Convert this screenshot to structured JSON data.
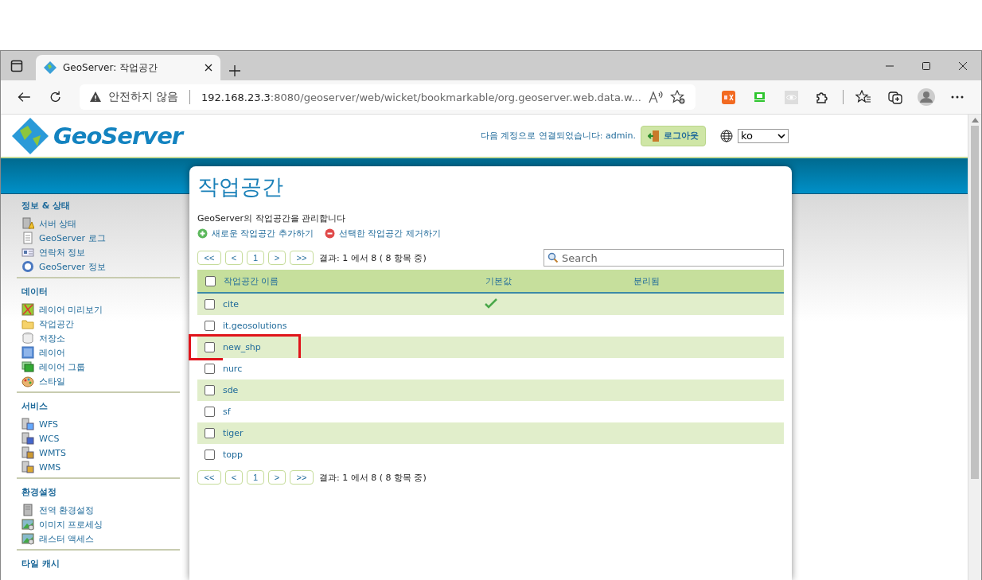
{
  "browser": {
    "tab_title": "GeoServer: 작업공간",
    "security": "안전하지 않음",
    "url_host": "192.168.23.3",
    "url_rest": ":8080/geoserver/web/wicket/bookmarkable/org.geoserver.web.data.w..."
  },
  "header": {
    "logo_text": "GeoServer",
    "connected": "다음 계정으로 연결되었습니다: admin.",
    "logout": "로그아웃",
    "language": "ko"
  },
  "sidebar": [
    {
      "title": "정보 & 상태",
      "items": [
        "서버 상태",
        "GeoServer 로그",
        "연락처 정보",
        "GeoServer 정보"
      ]
    },
    {
      "title": "데이터",
      "items": [
        "레이어 미리보기",
        "작업공간",
        "저장소",
        "레이어",
        "레이어 그룹",
        "스타일"
      ]
    },
    {
      "title": "서비스",
      "items": [
        "WFS",
        "WCS",
        "WMTS",
        "WMS"
      ]
    },
    {
      "title": "환경설정",
      "items": [
        "전역 환경설정",
        "이미지 프로세싱",
        "래스터 액세스"
      ]
    },
    {
      "title": "타일 캐시"
    }
  ],
  "page": {
    "title": "작업공간",
    "description": "GeoServer의 작업공간을 관리합니다",
    "add_link": "새로운 작업공간 추가하기",
    "remove_link": "선택한 작업공간 제거하기"
  },
  "pager": {
    "buttons": [
      "<<",
      "<",
      "1",
      ">",
      ">>"
    ],
    "result": "결과: 1 에서 8 ( 8 항목 중)"
  },
  "search": {
    "placeholder": "Search"
  },
  "table": {
    "columns": [
      "작업공간 이름",
      "기본값",
      "분리됨"
    ],
    "header_checked": false,
    "rows": [
      {
        "name": "cite",
        "checked": false,
        "default": true,
        "highlighted": false
      },
      {
        "name": "it.geosolutions",
        "checked": false,
        "default": false,
        "highlighted": false
      },
      {
        "name": "new_shp",
        "checked": false,
        "default": false,
        "highlighted": true
      },
      {
        "name": "nurc",
        "checked": false,
        "default": false,
        "highlighted": false
      },
      {
        "name": "sde",
        "checked": false,
        "default": false,
        "highlighted": false
      },
      {
        "name": "sf",
        "checked": false,
        "default": false,
        "highlighted": false
      },
      {
        "name": "tiger",
        "checked": false,
        "default": false,
        "highlighted": false
      },
      {
        "name": "topp",
        "checked": false,
        "default": false,
        "highlighted": false
      }
    ]
  },
  "pager_bottom": {
    "buttons": [
      "<<",
      "<",
      "1",
      ">",
      ">>"
    ],
    "result": "결과: 1 에서 8 ( 8 항목 중)"
  }
}
